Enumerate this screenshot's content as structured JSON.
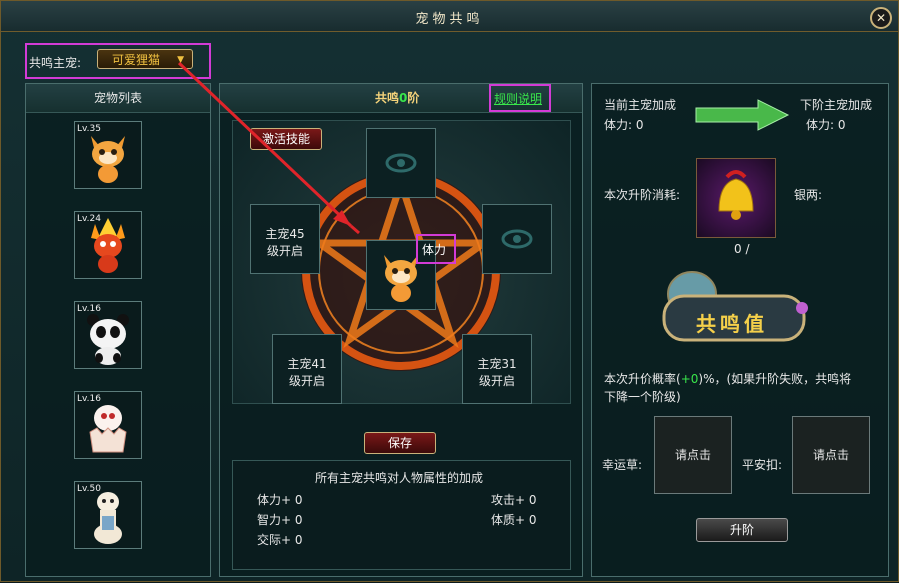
{
  "window": {
    "title": "宠物共鸣"
  },
  "header": {
    "label": "共鸣主宠:",
    "selected_pet": "可爱狸猫"
  },
  "pet_list": {
    "title": "宠物列表",
    "pets": [
      {
        "level": "Lv.35"
      },
      {
        "level": "Lv.24"
      },
      {
        "level": "Lv.16"
      },
      {
        "level": "Lv.16"
      },
      {
        "level": "Lv.50"
      }
    ]
  },
  "resonance": {
    "title_prefix": "共鸣",
    "tier": "0",
    "title_suffix": "阶",
    "rules_link": "规则说明",
    "activate_button": "激活技能",
    "center_tag": "体力",
    "slots": {
      "left": {
        "line1": "主宠45",
        "line2": "级开启"
      },
      "bottom_left": {
        "line1": "主宠41",
        "line2": "级开启"
      },
      "bottom_right": {
        "line1": "主宠31",
        "line2": "级开启"
      }
    },
    "save_button": "保存"
  },
  "bonus": {
    "title": "所有主宠共鸣对人物属性的加成",
    "stats": {
      "stamina": "体力+ 0",
      "intelligence": "智力+ 0",
      "social": "交际+ 0",
      "attack": "攻击+ 0",
      "physique": "体质+ 0"
    }
  },
  "upgrade": {
    "current_label": "当前主宠加成",
    "current_value": "体力: 0",
    "next_label": "下阶主宠加成",
    "next_value": "体力: 0",
    "cost_label": "本次升阶消耗:",
    "silver_label": "银两:",
    "item_count": "0 /",
    "resonance_value": "共鸣值",
    "rate_text_1": "本次升价概率(",
    "rate_value": "+0",
    "rate_text_2": ")%，(如果升阶失败，共鸣将",
    "rate_text_3": "下降一个阶级)",
    "luck_label": "幸运草:",
    "luck_slot": "请点击",
    "safe_label": "平安扣:",
    "safe_slot": "请点击",
    "upgrade_button": "升阶"
  },
  "colors": {
    "accent_green": "#39e64b",
    "highlight_box": "#d23bd6",
    "gold": "#f0b020",
    "arrow_red": "#e0242a"
  }
}
